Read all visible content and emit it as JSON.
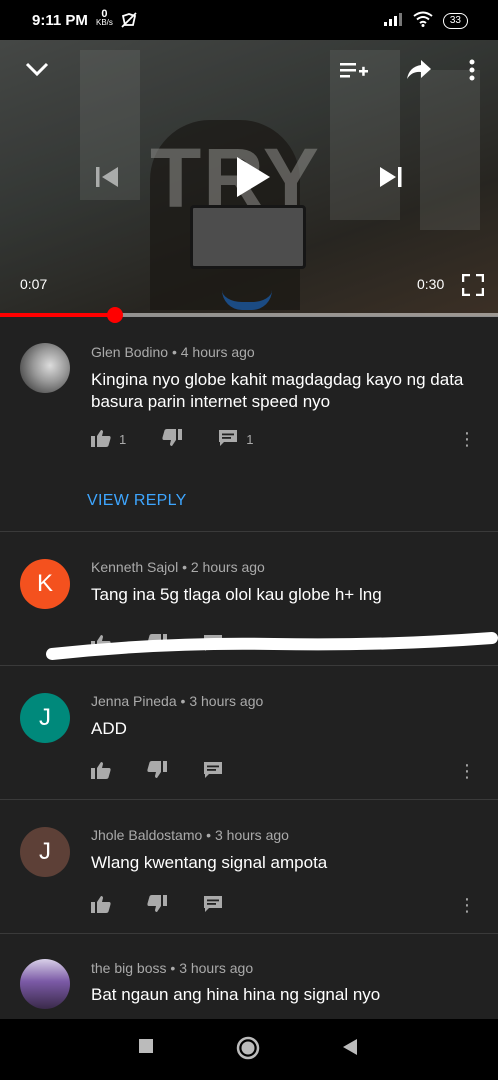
{
  "status_bar": {
    "time": "9:11 PM",
    "net_speed_value": "0",
    "net_speed_unit": "KB/s",
    "battery": "33"
  },
  "player": {
    "current_time": "0:07",
    "duration": "0:30",
    "progress": 0.23,
    "overlay_text": "TRY",
    "icons": [
      "chevron-down-icon",
      "add-to-queue-icon",
      "share-icon",
      "more-icon",
      "previous-icon",
      "play-icon",
      "next-icon",
      "fullscreen-icon"
    ]
  },
  "comments": [
    {
      "author": "Glen Bodino",
      "time": "4 hours ago",
      "text": "Kingina nyo globe kahit magdagdag kayo ng data basura parin internet speed nyo",
      "likes": "1",
      "replies": "1",
      "avatar_letter": "",
      "avatar_color": "#8e8e8e",
      "view_reply": "VIEW REPLY"
    },
    {
      "author": "Kenneth Sajol",
      "time": "2 hours ago",
      "text": "Tang ina 5g tlaga olol kau globe h+ lng",
      "avatar_letter": "K",
      "avatar_color": "#f4511e"
    },
    {
      "author": "Jenna Pineda",
      "time": "3 hours ago",
      "text": "ADD",
      "avatar_letter": "J",
      "avatar_color": "#00897b"
    },
    {
      "author": "Jhole Baldostamo",
      "time": "3 hours ago",
      "text": "Wlang kwentang signal ampota",
      "avatar_letter": "J",
      "avatar_color": "#5d4037"
    },
    {
      "author": "the big boss",
      "time": "3 hours ago",
      "text": "Bat ngaun ang hina hina ng signal nyo",
      "avatar_letter": "",
      "avatar_color": "#6a4c8c"
    }
  ],
  "colors": {
    "background": "#212121",
    "accent_red": "#ff0000",
    "link_blue": "#3ea6ff"
  }
}
